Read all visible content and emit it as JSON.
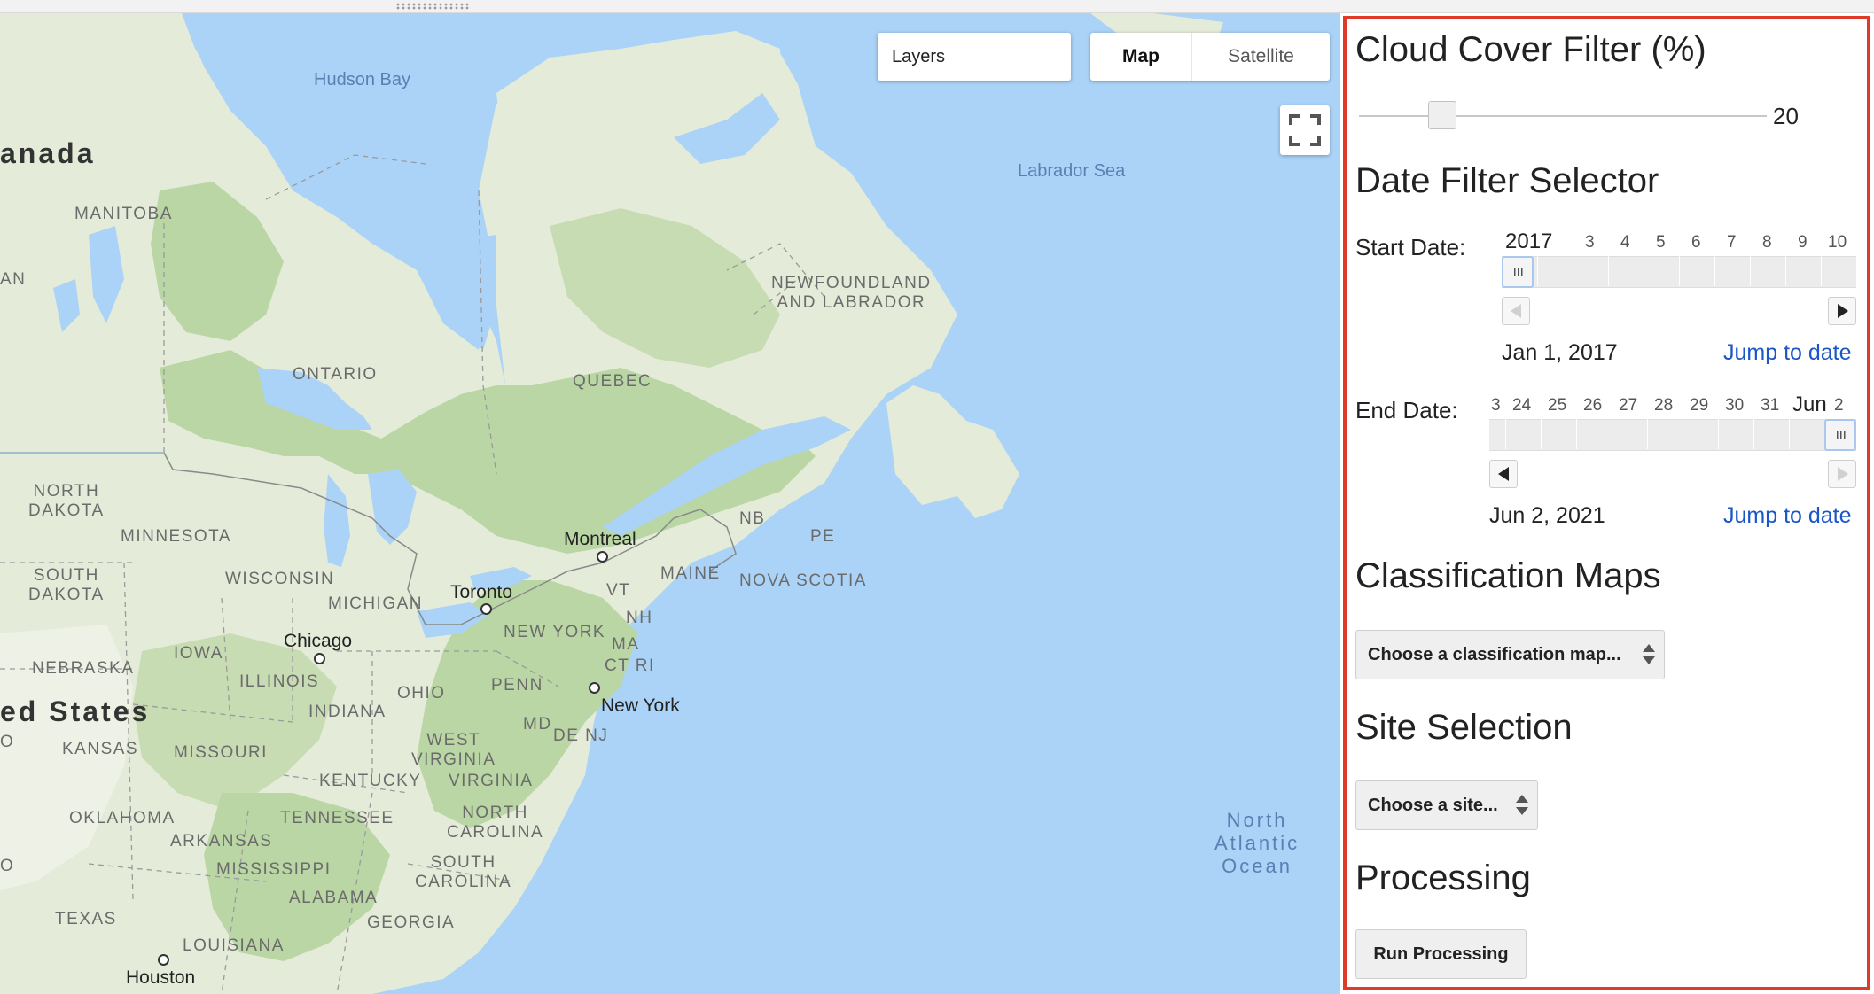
{
  "map": {
    "layers_label": "Layers",
    "map_type_map": "Map",
    "map_type_satellite": "Satellite",
    "water_labels": [
      "Hudson Bay",
      "Labrador Sea"
    ],
    "ocean_label": [
      "North",
      "Atlantic",
      "Ocean"
    ],
    "country_labels": [
      "anada",
      "ed States"
    ],
    "region_labels": {
      "manitoba": "MANITOBA",
      "an": "AN",
      "ontario": "ONTARIO",
      "quebec": "QUEBEC",
      "newfoundland": [
        "NEWFOUNDLAND",
        "AND LABRADOR"
      ],
      "north_dakota": [
        "NORTH",
        "DAKOTA"
      ],
      "south_dakota": [
        "SOUTH",
        "DAKOTA"
      ],
      "minnesota": "MINNESOTA",
      "wisconsin": "WISCONSIN",
      "michigan": "MICHIGAN",
      "nebraska": "NEBRASKA",
      "iowa": "IOWA",
      "illinois": "ILLINOIS",
      "indiana": "INDIANA",
      "ohio": "OHIO",
      "penn": "PENN",
      "new_york_state": "NEW YORK",
      "maine": "MAINE",
      "vt": "VT",
      "nh": "NH",
      "ma": "MA",
      "ct_ri": "CT RI",
      "md": "MD",
      "de_nj": "DE NJ",
      "nb": "NB",
      "pe": "PE",
      "nova_scotia": "NOVA SCOTIA",
      "kansas": "KANSAS",
      "missouri": "MISSOURI",
      "west_virginia": [
        "WEST",
        "VIRGINIA"
      ],
      "kentucky": "KENTUCKY",
      "virginia": "VIRGINIA",
      "oklahoma": "OKLAHOMA",
      "arkansas": "ARKANSAS",
      "tennessee": "TENNESSEE",
      "north_carolina": [
        "NORTH",
        "CAROLINA"
      ],
      "south_carolina": [
        "SOUTH",
        "CAROLINA"
      ],
      "mississippi": "MISSISSIPPI",
      "alabama": "ALABAMA",
      "georgia": "GEORGIA",
      "texas": "TEXAS",
      "louisiana": "LOUISIANA",
      "edge_o_upper": "O",
      "edge_o_lower": "O"
    },
    "cities": {
      "montreal": "Montreal",
      "toronto": "Toronto",
      "chicago": "Chicago",
      "new_york": "New York",
      "houston": "Houston"
    }
  },
  "panel": {
    "cloud_cover_title": "Cloud Cover Filter (%)",
    "cloud_cover_value": 20,
    "date_filter_title": "Date Filter Selector",
    "start": {
      "label": "Start Date:",
      "ticks": [
        "2017",
        "3",
        "4",
        "5",
        "6",
        "7",
        "8",
        "9",
        "10"
      ],
      "date": "Jan 1, 2017",
      "jump": "Jump to date"
    },
    "end": {
      "label": "End Date:",
      "ticks": [
        "3",
        "24",
        "25",
        "26",
        "27",
        "28",
        "29",
        "30",
        "31",
        "Jun",
        "2"
      ],
      "date": "Jun 2, 2021",
      "jump": "Jump to date"
    },
    "classification_title": "Classification Maps",
    "classification_select": "Choose a classification map...",
    "site_title": "Site Selection",
    "site_select": "Choose a site...",
    "processing_title": "Processing",
    "run_button": "Run Processing"
  },
  "colors": {
    "panel_border": "#de3b2b",
    "link": "#1a56c8",
    "water": "#aad3f7",
    "land": "#e4ecd9",
    "forest": "#b9d6a4"
  }
}
